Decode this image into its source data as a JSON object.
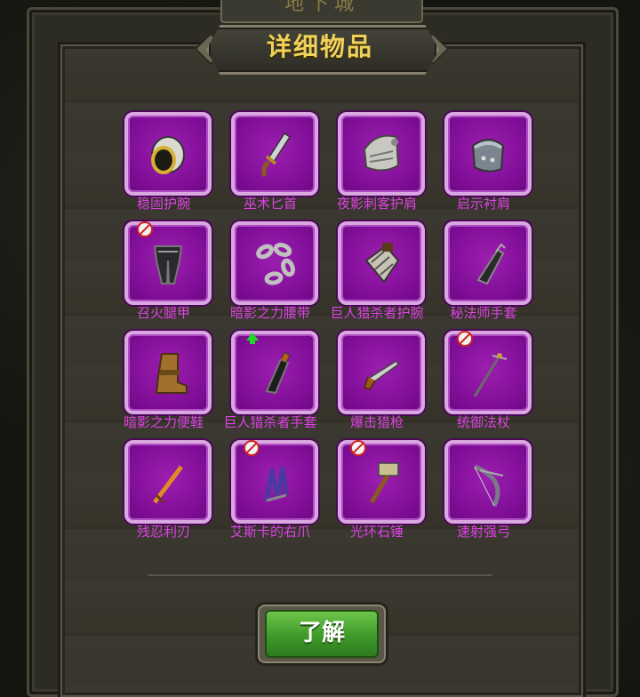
{
  "header": {
    "back_tab_label": "地下城",
    "title": "详细物品"
  },
  "items": [
    {
      "label": "稳固护腕",
      "icon": "bracer-icon",
      "badge": "none"
    },
    {
      "label": "巫术匕首",
      "icon": "dagger-icon",
      "badge": "none"
    },
    {
      "label": "夜影刺客护肩",
      "icon": "shoulder-armor-icon",
      "badge": "none"
    },
    {
      "label": "启示衬肩",
      "icon": "pauldron-icon",
      "badge": "none"
    },
    {
      "label": "召火腿甲",
      "icon": "leg-armor-icon",
      "badge": "forbidden"
    },
    {
      "label": "暗影之力腰带",
      "icon": "chain-belt-icon",
      "badge": "none"
    },
    {
      "label": "巨人猎杀者护腕",
      "icon": "gauntlet-bracer-icon",
      "badge": "none"
    },
    {
      "label": "秘法师手套",
      "icon": "glove-icon",
      "badge": "none"
    },
    {
      "label": "暗影之力便鞋",
      "icon": "boot-icon",
      "badge": "none"
    },
    {
      "label": "巨人猎杀者手套",
      "icon": "dark-glove-icon",
      "badge": "upgrade"
    },
    {
      "label": "爆击猎枪",
      "icon": "gun-icon",
      "badge": "none"
    },
    {
      "label": "统御法杖",
      "icon": "staff-icon",
      "badge": "forbidden"
    },
    {
      "label": "残忍利刃",
      "icon": "sword-icon",
      "badge": "none"
    },
    {
      "label": "艾斯卡的右爪",
      "icon": "claw-icon",
      "badge": "forbidden"
    },
    {
      "label": "光环石锤",
      "icon": "hammer-icon",
      "badge": "forbidden"
    },
    {
      "label": "速射强弓",
      "icon": "bow-icon",
      "badge": "none"
    }
  ],
  "ok_button": {
    "label": "了解"
  },
  "colors": {
    "tile": "#8a10a2",
    "label": "#e040e8",
    "title": "#f0d25a",
    "button": "#4fae32"
  }
}
